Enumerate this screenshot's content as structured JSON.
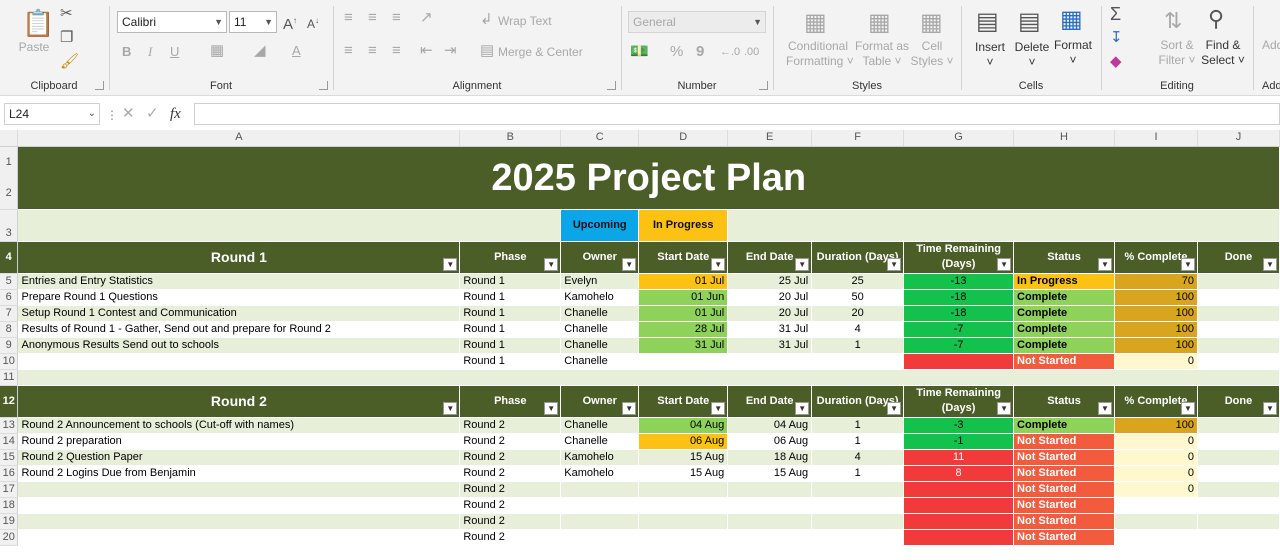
{
  "ribbon": {
    "clipboard": {
      "label": "Clipboard",
      "paste": "Paste"
    },
    "font": {
      "label": "Font",
      "name": "Calibri",
      "size": "11",
      "bold": "B",
      "italic": "I",
      "underline": "U",
      "grow": "A",
      "shrink": "A",
      "color_letter": "A"
    },
    "alignment": {
      "label": "Alignment",
      "wrap": "Wrap Text",
      "merge": "Merge & Center"
    },
    "number": {
      "label": "Number",
      "format": "General",
      "percent": "%",
      "comma": "9"
    },
    "styles": {
      "label": "Styles",
      "cond1": "Conditional",
      "cond2": "Formatting",
      "fmt1": "Format as",
      "fmt2": "Table",
      "cell1": "Cell",
      "cell2": "Styles"
    },
    "cells": {
      "label": "Cells",
      "insert": "Insert",
      "delete": "Delete",
      "format": "Format"
    },
    "editing": {
      "label": "Editing",
      "sort1": "Sort &",
      "sort2": "Filter",
      "find1": "Find &",
      "find2": "Select"
    },
    "addins": {
      "label": "Add"
    }
  },
  "formula_bar": {
    "name_box": "L24",
    "fx": "fx",
    "content": ""
  },
  "columns": [
    "A",
    "B",
    "C",
    "D",
    "E",
    "F",
    "G",
    "H",
    "I",
    "J"
  ],
  "sheet": {
    "title": "2025 Project Plan",
    "legend": {
      "upcoming": "Upcoming",
      "in_progress": "In Progress"
    },
    "headers": [
      "Phase",
      "Owner",
      "Start Date",
      "End Date",
      "Duration (Days)",
      "Time Remaining (Days)",
      "Status",
      "% Complete",
      "Done"
    ],
    "round1": {
      "name": "Round 1",
      "rows": [
        {
          "task": "Entries and Entry Statistics",
          "phase": "Round 1",
          "owner": "Evelyn",
          "start": "01 Jul",
          "end": "25 Jul",
          "dur": "25",
          "rem": "-13",
          "status": "In Progress",
          "pct": "70"
        },
        {
          "task": "Prepare Round 1 Questions",
          "phase": "Round 1",
          "owner": "Kamohelo",
          "start": "01 Jun",
          "end": "20 Jul",
          "dur": "50",
          "rem": "-18",
          "status": "Complete",
          "pct": "100"
        },
        {
          "task": "Setup Round 1 Contest and Communication",
          "phase": "Round 1",
          "owner": "Chanelle",
          "start": "01 Jul",
          "end": "20 Jul",
          "dur": "20",
          "rem": "-18",
          "status": "Complete",
          "pct": "100"
        },
        {
          "task": "Results of Round 1 - Gather, Send out and prepare for Round 2",
          "phase": "Round 1",
          "owner": "Chanelle",
          "start": "28 Jul",
          "end": "31 Jul",
          "dur": "4",
          "rem": "-7",
          "status": "Complete",
          "pct": "100"
        },
        {
          "task": "Anonymous Results Send out to schools",
          "phase": "Round 1",
          "owner": "Chanelle",
          "start": "31 Jul",
          "end": "31 Jul",
          "dur": "1",
          "rem": "-7",
          "status": "Complete",
          "pct": "100"
        },
        {
          "task": "",
          "phase": "Round 1",
          "owner": "Chanelle",
          "start": "",
          "end": "",
          "dur": "",
          "rem": "",
          "status": "Not Started",
          "pct": "0"
        }
      ]
    },
    "round2": {
      "name": "Round 2",
      "rows": [
        {
          "task": "Round 2 Announcement to schools (Cut-off with names)",
          "phase": "Round 2",
          "owner": "Chanelle",
          "start": "04 Aug",
          "end": "04 Aug",
          "dur": "1",
          "rem": "-3",
          "status": "Complete",
          "pct": "100"
        },
        {
          "task": "Round 2 preparation",
          "phase": "Round 2",
          "owner": "Chanelle",
          "start": "06 Aug",
          "end": "06 Aug",
          "dur": "1",
          "rem": "-1",
          "status": "Not Started",
          "pct": "0"
        },
        {
          "task": "Round 2 Question Paper",
          "phase": "Round 2",
          "owner": "Kamohelo",
          "start": "15 Aug",
          "end": "18 Aug",
          "dur": "4",
          "rem": "11",
          "status": "Not Started",
          "pct": "0"
        },
        {
          "task": "Round 2 Logins Due from Benjamin",
          "phase": "Round 2",
          "owner": "Kamohelo",
          "start": "15 Aug",
          "end": "15 Aug",
          "dur": "1",
          "rem": "8",
          "status": "Not Started",
          "pct": "0"
        },
        {
          "task": "",
          "phase": "Round 2",
          "owner": "",
          "start": "",
          "end": "",
          "dur": "",
          "rem": "",
          "status": "Not Started",
          "pct": "0"
        },
        {
          "task": "",
          "phase": "Round 2",
          "owner": "",
          "start": "",
          "end": "",
          "dur": "",
          "rem": "",
          "status": "Not Started",
          "pct": ""
        },
        {
          "task": "",
          "phase": "Round 2",
          "owner": "",
          "start": "",
          "end": "",
          "dur": "",
          "rem": "",
          "status": "Not Started",
          "pct": ""
        },
        {
          "task": "",
          "phase": "Round 2",
          "owner": "",
          "start": "",
          "end": "",
          "dur": "",
          "rem": "",
          "status": "Not Started",
          "pct": ""
        }
      ]
    }
  },
  "row_numbers": [
    "1",
    "2",
    "3",
    "4",
    "5",
    "6",
    "7",
    "8",
    "9",
    "10",
    "11",
    "12",
    "13",
    "14",
    "15",
    "16",
    "17",
    "18",
    "19",
    "20"
  ],
  "colors": {
    "header_green": "#4b5e28",
    "light_green": "#e7efd9",
    "upcoming": "#0aa6e8",
    "in_progress": "#fbc213",
    "not_started": "#f35b3d",
    "complete": "#8ed25a"
  }
}
